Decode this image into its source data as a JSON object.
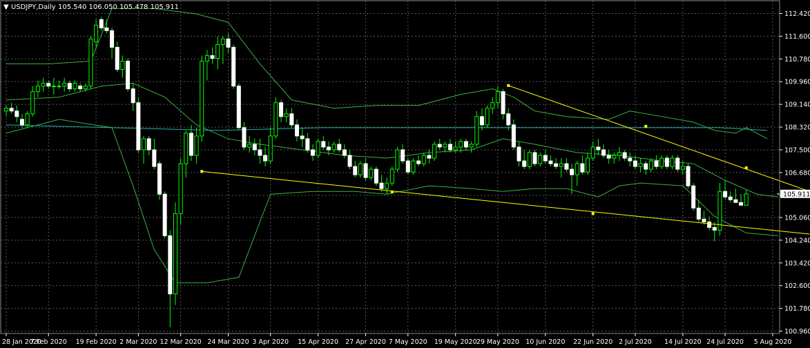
{
  "header": {
    "arrow": "▼",
    "symbol": "USDJPY,Daily",
    "ohlc": "105.540 106.050 105.478 105.911"
  },
  "colors": {
    "background": "#000000",
    "grid": "#5a5a5a",
    "axis_text": "#ffffff",
    "bull_body": "#000000",
    "bull_outline": "#00ff00",
    "bear_body": "#ffffff",
    "wick": "#00ff00",
    "bollinger": "#3cb043",
    "moving_average": "#20b2aa",
    "trendline": "#ffff00",
    "price_label_bg": "#ffffff",
    "price_label_text": "#000000"
  },
  "chart_data": {
    "type": "candlestick",
    "symbol": "USDJPY",
    "timeframe": "Daily",
    "current_price": "105.911",
    "y_ticks": [
      "112.420",
      "111.600",
      "110.780",
      "109.960",
      "109.140",
      "108.320",
      "107.500",
      "106.680",
      "105.860",
      "105.060",
      "104.240",
      "103.420",
      "102.600",
      "101.780",
      "100.960"
    ],
    "y_tick_values": [
      112.42,
      111.6,
      110.78,
      109.96,
      109.14,
      108.32,
      107.5,
      106.68,
      105.86,
      105.06,
      104.24,
      103.42,
      102.6,
      101.78,
      100.96
    ],
    "ylim": [
      100.96,
      112.42
    ],
    "x_tick_labels": [
      "28 Jan 2020",
      "7 Feb 2020",
      "19 Feb 2020",
      "2 Mar 2020",
      "12 Mar 2020",
      "24 Mar 2020",
      "3 Apr 2020",
      "15 Apr 2020",
      "27 Apr 2020",
      "7 May 2020",
      "19 May 2020",
      "29 May 2020",
      "10 Jun 2020",
      "22 Jun 2020",
      "2 Jul 2020",
      "14 Jul 2020",
      "24 Jul 2020",
      "5 Aug 2020"
    ],
    "x_tick_index": [
      0,
      8,
      17,
      25,
      33,
      42,
      50,
      59,
      68,
      76,
      85,
      93,
      102,
      111,
      119,
      128,
      136,
      145
    ],
    "candles": [
      [
        108.9,
        109.1,
        108.7,
        109.0
      ],
      [
        109.0,
        109.2,
        108.8,
        108.9
      ],
      [
        108.9,
        109.1,
        108.5,
        108.7
      ],
      [
        108.6,
        108.8,
        108.3,
        108.4
      ],
      [
        108.4,
        108.9,
        108.3,
        108.8
      ],
      [
        108.8,
        109.8,
        108.7,
        109.6
      ],
      [
        109.6,
        110.0,
        109.4,
        109.8
      ],
      [
        109.8,
        110.1,
        109.6,
        109.9
      ],
      [
        109.9,
        110.0,
        109.7,
        109.8
      ],
      [
        109.8,
        110.1,
        109.5,
        109.8
      ],
      [
        109.8,
        110.0,
        109.7,
        109.8
      ],
      [
        109.8,
        110.1,
        109.6,
        109.9
      ],
      [
        109.9,
        110.0,
        109.6,
        109.7
      ],
      [
        109.7,
        110.0,
        109.6,
        109.9
      ],
      [
        109.8,
        109.9,
        109.6,
        109.7
      ],
      [
        109.7,
        109.9,
        109.6,
        109.8
      ],
      [
        109.8,
        111.6,
        109.7,
        111.5
      ],
      [
        111.4,
        112.2,
        111.2,
        112.0
      ],
      [
        112.2,
        112.3,
        111.8,
        111.9
      ],
      [
        111.9,
        112.2,
        111.7,
        111.8
      ],
      [
        111.8,
        111.9,
        110.8,
        111.2
      ],
      [
        111.2,
        111.4,
        110.3,
        110.4
      ],
      [
        110.4,
        110.9,
        110.1,
        110.7
      ],
      [
        110.7,
        110.8,
        109.6,
        109.7
      ],
      [
        109.7,
        109.9,
        108.9,
        109.2
      ],
      [
        109.2,
        109.4,
        107.4,
        107.5
      ],
      [
        107.5,
        108.0,
        107.0,
        107.9
      ],
      [
        107.9,
        108.0,
        107.3,
        107.5
      ],
      [
        107.5,
        107.9,
        106.8,
        106.9
      ],
      [
        107.0,
        107.1,
        105.7,
        105.9
      ],
      [
        105.9,
        106.0,
        104.3,
        104.4
      ],
      [
        104.4,
        104.6,
        101.1,
        102.3
      ],
      [
        102.3,
        105.6,
        101.9,
        105.2
      ],
      [
        105.2,
        107.2,
        104.8,
        107.0
      ],
      [
        107.0,
        108.2,
        106.5,
        108.1
      ],
      [
        108.1,
        108.4,
        107.1,
        107.3
      ],
      [
        107.3,
        108.3,
        107.0,
        108.0
      ],
      [
        108.0,
        110.9,
        107.8,
        110.7
      ],
      [
        110.7,
        111.1,
        110.0,
        110.9
      ],
      [
        110.9,
        111.2,
        110.6,
        110.8
      ],
      [
        110.8,
        111.6,
        110.4,
        111.3
      ],
      [
        111.3,
        111.6,
        110.6,
        111.5
      ],
      [
        111.5,
        111.7,
        111.0,
        111.2
      ],
      [
        111.2,
        111.3,
        109.7,
        109.8
      ],
      [
        109.8,
        109.9,
        108.2,
        108.3
      ],
      [
        108.3,
        108.5,
        107.5,
        107.6
      ],
      [
        107.6,
        108.0,
        107.4,
        107.7
      ],
      [
        107.7,
        107.9,
        107.3,
        107.5
      ],
      [
        107.5,
        107.9,
        107.0,
        107.3
      ],
      [
        107.3,
        107.6,
        106.9,
        107.1
      ],
      [
        107.1,
        108.3,
        107.0,
        108.0
      ],
      [
        108.0,
        109.4,
        107.9,
        109.2
      ],
      [
        109.2,
        109.3,
        108.5,
        108.7
      ],
      [
        108.7,
        109.0,
        108.5,
        108.8
      ],
      [
        108.8,
        109.0,
        108.3,
        108.4
      ],
      [
        108.4,
        108.6,
        107.8,
        108.0
      ],
      [
        108.0,
        108.3,
        107.6,
        107.9
      ],
      [
        107.9,
        108.1,
        107.4,
        107.5
      ],
      [
        107.5,
        107.7,
        107.1,
        107.3
      ],
      [
        107.3,
        107.9,
        107.2,
        107.8
      ],
      [
        107.8,
        108.0,
        107.5,
        107.6
      ],
      [
        107.6,
        107.8,
        107.3,
        107.5
      ],
      [
        107.5,
        107.8,
        107.4,
        107.7
      ],
      [
        107.7,
        107.9,
        107.4,
        107.5
      ],
      [
        107.5,
        107.7,
        107.2,
        107.3
      ],
      [
        107.3,
        107.5,
        106.8,
        106.9
      ],
      [
        106.9,
        107.1,
        106.5,
        106.6
      ],
      [
        106.6,
        107.1,
        106.5,
        107.0
      ],
      [
        107.0,
        107.2,
        106.4,
        106.5
      ],
      [
        106.5,
        106.9,
        106.4,
        106.8
      ],
      [
        106.8,
        106.9,
        106.2,
        106.3
      ],
      [
        106.3,
        106.6,
        106.0,
        106.1
      ],
      [
        106.1,
        106.5,
        105.9,
        106.3
      ],
      [
        106.3,
        106.9,
        106.2,
        106.8
      ],
      [
        106.8,
        107.6,
        106.7,
        107.5
      ],
      [
        107.5,
        107.7,
        107.0,
        107.1
      ],
      [
        107.1,
        107.2,
        106.6,
        106.7
      ],
      [
        106.7,
        107.2,
        106.6,
        107.1
      ],
      [
        107.1,
        107.3,
        106.9,
        107.0
      ],
      [
        107.0,
        107.4,
        106.9,
        107.3
      ],
      [
        107.3,
        107.5,
        107.0,
        107.2
      ],
      [
        107.2,
        107.8,
        107.1,
        107.7
      ],
      [
        107.7,
        107.9,
        107.5,
        107.6
      ],
      [
        107.6,
        107.8,
        107.4,
        107.7
      ],
      [
        107.7,
        107.9,
        107.4,
        107.5
      ],
      [
        107.5,
        107.8,
        107.4,
        107.6
      ],
      [
        107.6,
        107.9,
        107.4,
        107.8
      ],
      [
        107.8,
        107.9,
        107.5,
        107.6
      ],
      [
        107.6,
        107.8,
        107.4,
        107.7
      ],
      [
        107.7,
        108.9,
        107.6,
        108.7
      ],
      [
        108.7,
        109.0,
        108.2,
        108.4
      ],
      [
        108.4,
        109.1,
        108.3,
        109.0
      ],
      [
        109.0,
        109.4,
        108.8,
        109.2
      ],
      [
        109.2,
        109.8,
        109.0,
        109.6
      ],
      [
        109.6,
        109.7,
        108.6,
        108.8
      ],
      [
        108.8,
        109.0,
        108.2,
        108.4
      ],
      [
        108.4,
        108.6,
        107.5,
        107.6
      ],
      [
        107.6,
        107.8,
        106.9,
        107.1
      ],
      [
        107.1,
        107.5,
        106.8,
        106.9
      ],
      [
        106.9,
        107.5,
        106.8,
        107.4
      ],
      [
        107.4,
        107.5,
        106.9,
        107.0
      ],
      [
        107.0,
        107.4,
        106.9,
        107.3
      ],
      [
        107.3,
        107.5,
        107.0,
        107.1
      ],
      [
        107.1,
        107.3,
        106.9,
        107.0
      ],
      [
        107.0,
        107.2,
        106.8,
        106.9
      ],
      [
        106.9,
        107.2,
        106.5,
        107.0
      ],
      [
        107.0,
        107.2,
        106.7,
        106.8
      ],
      [
        106.8,
        107.0,
        105.9,
        106.6
      ],
      [
        106.6,
        107.1,
        106.2,
        107.0
      ],
      [
        107.0,
        107.3,
        106.6,
        106.7
      ],
      [
        106.7,
        107.4,
        106.6,
        107.2
      ],
      [
        107.2,
        107.8,
        107.1,
        107.6
      ],
      [
        107.6,
        107.9,
        107.3,
        107.5
      ],
      [
        107.5,
        107.7,
        107.2,
        107.3
      ],
      [
        107.3,
        107.5,
        107.0,
        107.2
      ],
      [
        107.2,
        107.4,
        107.0,
        107.3
      ],
      [
        107.3,
        107.6,
        107.1,
        107.4
      ],
      [
        107.4,
        107.5,
        107.1,
        107.2
      ],
      [
        107.2,
        107.4,
        106.9,
        107.1
      ],
      [
        107.1,
        107.3,
        106.8,
        106.9
      ],
      [
        106.9,
        107.2,
        106.7,
        107.0
      ],
      [
        107.0,
        107.1,
        106.6,
        106.8
      ],
      [
        106.8,
        107.2,
        106.7,
        107.1
      ],
      [
        107.1,
        107.3,
        106.8,
        106.9
      ],
      [
        106.9,
        107.3,
        106.8,
        107.2
      ],
      [
        107.2,
        107.3,
        106.8,
        106.9
      ],
      [
        106.9,
        107.3,
        106.8,
        107.2
      ],
      [
        107.2,
        107.3,
        106.7,
        106.8
      ],
      [
        106.8,
        107.1,
        106.6,
        106.9
      ],
      [
        106.9,
        107.0,
        106.1,
        106.2
      ],
      [
        106.2,
        106.3,
        105.3,
        105.4
      ],
      [
        105.4,
        105.7,
        104.9,
        105.0
      ],
      [
        105.0,
        105.3,
        104.8,
        104.9
      ],
      [
        104.9,
        105.1,
        104.6,
        104.7
      ],
      [
        104.7,
        104.9,
        104.2,
        104.6
      ],
      [
        104.6,
        106.3,
        104.4,
        106.0
      ],
      [
        106.0,
        106.4,
        105.7,
        105.8
      ],
      [
        105.8,
        106.0,
        105.6,
        105.7
      ],
      [
        105.7,
        106.1,
        105.6,
        105.6
      ],
      [
        105.6,
        105.9,
        105.5,
        105.5
      ],
      [
        105.5,
        106.05,
        105.478,
        105.911
      ]
    ],
    "ma_points": [
      [
        0,
        108.4
      ],
      [
        20,
        108.3
      ],
      [
        40,
        108.2
      ],
      [
        60,
        108.3
      ],
      [
        80,
        108.3
      ],
      [
        100,
        108.3
      ],
      [
        120,
        108.3
      ],
      [
        135,
        108.3
      ],
      [
        144,
        108.2
      ]
    ],
    "bb_upper": [
      [
        0,
        110.6
      ],
      [
        8,
        110.6
      ],
      [
        16,
        110.7
      ],
      [
        20,
        112.6
      ],
      [
        28,
        112.6
      ],
      [
        36,
        112.4
      ],
      [
        42,
        112.1
      ],
      [
        48,
        110.6
      ],
      [
        54,
        109.3
      ],
      [
        62,
        109.0
      ],
      [
        70,
        109.1
      ],
      [
        78,
        109.1
      ],
      [
        86,
        109.5
      ],
      [
        92,
        109.7
      ],
      [
        96,
        109.4
      ],
      [
        100,
        108.9
      ],
      [
        106,
        108.7
      ],
      [
        114,
        108.6
      ],
      [
        118,
        108.9
      ],
      [
        124,
        108.7
      ],
      [
        130,
        108.5
      ],
      [
        134,
        108.2
      ],
      [
        138,
        108.1
      ],
      [
        140,
        108.3
      ],
      [
        144,
        107.9
      ]
    ],
    "bb_lower": [
      [
        0,
        108.1
      ],
      [
        10,
        108.6
      ],
      [
        20,
        108.3
      ],
      [
        24,
        106.2
      ],
      [
        28,
        103.9
      ],
      [
        32,
        102.7
      ],
      [
        38,
        102.7
      ],
      [
        44,
        102.9
      ],
      [
        50,
        105.9
      ],
      [
        58,
        106.0
      ],
      [
        66,
        106.0
      ],
      [
        72,
        105.9
      ],
      [
        80,
        106.2
      ],
      [
        88,
        106.1
      ],
      [
        94,
        106.0
      ],
      [
        100,
        106.1
      ],
      [
        106,
        106.1
      ],
      [
        112,
        105.8
      ],
      [
        116,
        106.2
      ],
      [
        120,
        106.3
      ],
      [
        128,
        106.2
      ],
      [
        134,
        105.1
      ],
      [
        140,
        104.5
      ],
      [
        146,
        104.4
      ]
    ],
    "bb_mid": [
      [
        0,
        109.3
      ],
      [
        10,
        109.4
      ],
      [
        18,
        109.8
      ],
      [
        24,
        109.9
      ],
      [
        30,
        109.4
      ],
      [
        36,
        108.4
      ],
      [
        42,
        107.9
      ],
      [
        48,
        107.7
      ],
      [
        56,
        107.5
      ],
      [
        64,
        107.3
      ],
      [
        72,
        107.2
      ],
      [
        80,
        107.4
      ],
      [
        88,
        107.5
      ],
      [
        94,
        107.9
      ],
      [
        100,
        107.7
      ],
      [
        108,
        107.4
      ],
      [
        116,
        107.3
      ],
      [
        124,
        107.1
      ],
      [
        130,
        107.0
      ],
      [
        136,
        106.4
      ],
      [
        142,
        105.9
      ],
      [
        146,
        105.8
      ]
    ],
    "trendlines": [
      {
        "from": [
          37,
          106.72
        ],
        "to": [
          152,
          104.46
        ]
      },
      {
        "from": [
          95,
          109.82
        ],
        "to": [
          152,
          106.0
        ]
      }
    ],
    "anchors": [
      [
        37,
        106.72
      ],
      [
        73,
        105.98
      ],
      [
        111,
        105.2
      ],
      [
        95,
        109.82
      ],
      [
        121,
        108.35
      ],
      [
        140,
        106.85
      ]
    ]
  }
}
